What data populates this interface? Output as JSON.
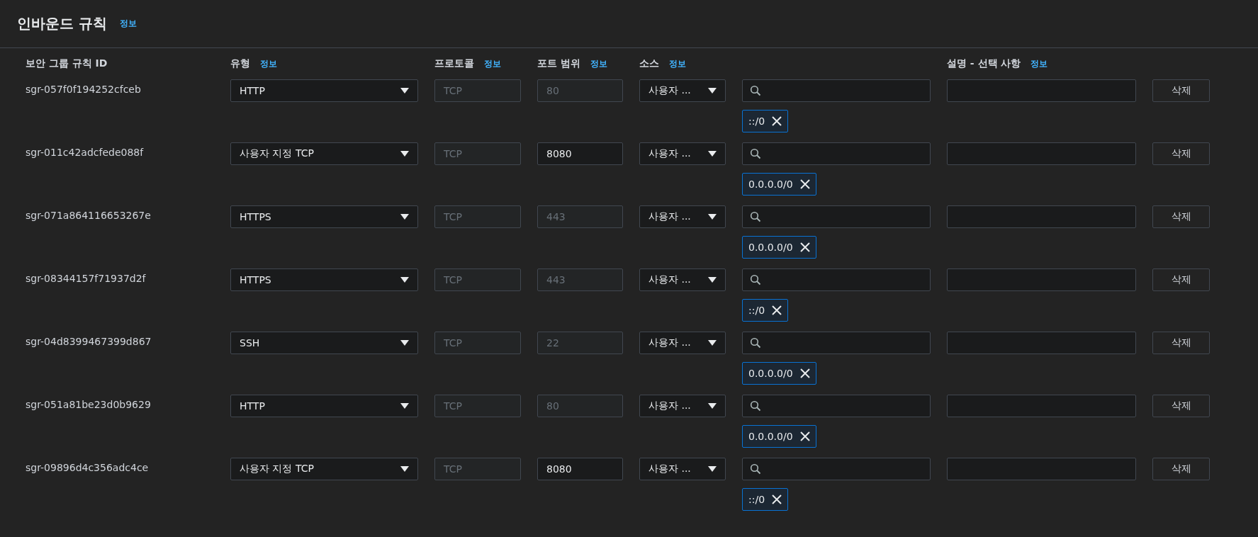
{
  "section": {
    "title": "인바운드 규칙",
    "info": "정보"
  },
  "columns": [
    {
      "label": "보안 그룹 규칙 ID"
    },
    {
      "label": "유형",
      "info": "정보"
    },
    {
      "label": "프로토콜",
      "info": "정보"
    },
    {
      "label": "포트 범위",
      "info": "정보"
    },
    {
      "label": "소스",
      "info": "정보"
    },
    {
      "label": "설명 - 선택 사항",
      "info": "정보"
    }
  ],
  "rules": [
    {
      "id": "sgr-057f0f194252cfceb",
      "type": "HTTP",
      "protocol": "TCP",
      "port": "80",
      "port_disabled": true,
      "source": "사용자 ...",
      "cidrs": [
        "::/0"
      ],
      "delete": "삭제"
    },
    {
      "id": "sgr-011c42adcfede088f",
      "type": "사용자 지정 TCP",
      "protocol": "TCP",
      "port": "8080",
      "port_disabled": false,
      "source": "사용자 ...",
      "cidrs": [
        "0.0.0.0/0"
      ],
      "delete": "삭제"
    },
    {
      "id": "sgr-071a864116653267e",
      "type": "HTTPS",
      "protocol": "TCP",
      "port": "443",
      "port_disabled": true,
      "source": "사용자 ...",
      "cidrs": [
        "0.0.0.0/0"
      ],
      "delete": "삭제"
    },
    {
      "id": "sgr-08344157f71937d2f",
      "type": "HTTPS",
      "protocol": "TCP",
      "port": "443",
      "port_disabled": true,
      "source": "사용자 ...",
      "cidrs": [
        "::/0"
      ],
      "delete": "삭제"
    },
    {
      "id": "sgr-04d8399467399d867",
      "type": "SSH",
      "protocol": "TCP",
      "port": "22",
      "port_disabled": true,
      "source": "사용자 ...",
      "cidrs": [
        "0.0.0.0/0"
      ],
      "delete": "삭제"
    },
    {
      "id": "sgr-051a81be23d0b9629",
      "type": "HTTP",
      "protocol": "TCP",
      "port": "80",
      "port_disabled": true,
      "source": "사용자 ...",
      "cidrs": [
        "0.0.0.0/0"
      ],
      "delete": "삭제"
    },
    {
      "id": "sgr-09896d4c356adc4ce",
      "type": "사용자 지정 TCP",
      "protocol": "TCP",
      "port": "8080",
      "port_disabled": false,
      "source": "사용자 ...",
      "cidrs": [
        "::/0"
      ],
      "delete": "삭제"
    }
  ]
}
